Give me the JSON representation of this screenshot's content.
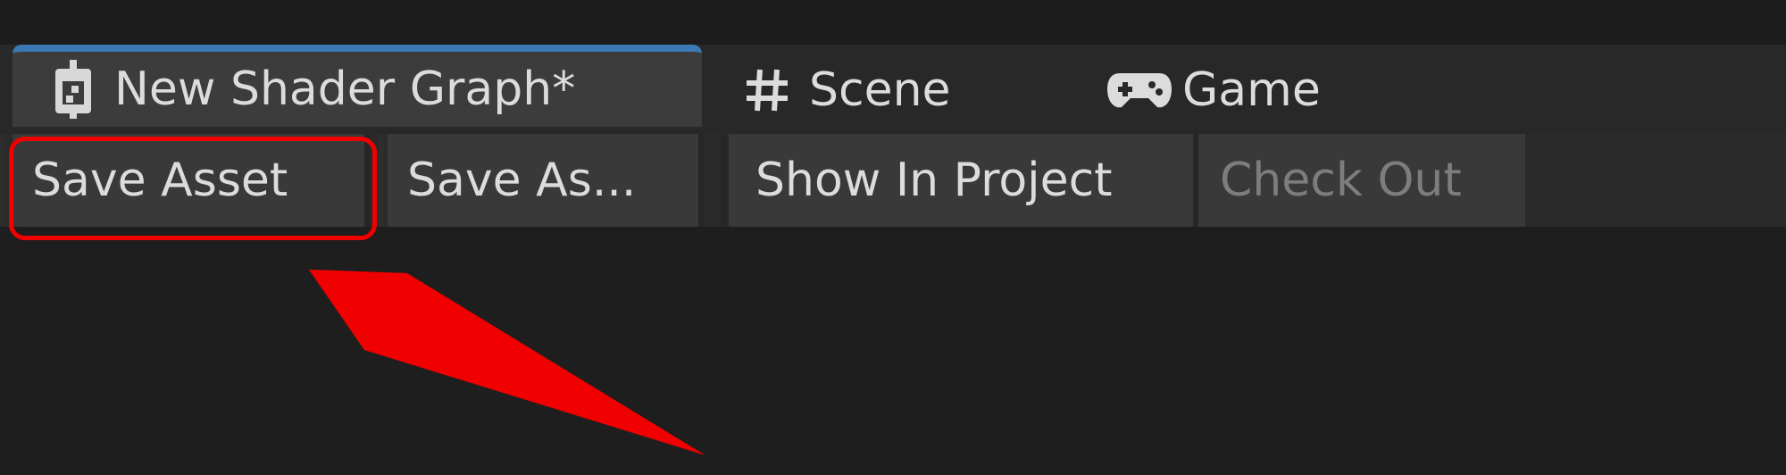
{
  "window": {
    "tabs": [
      {
        "label": "New Shader Graph*",
        "icon": "shader-graph-icon",
        "active": true
      },
      {
        "label": "Scene",
        "icon": "hash-grid-icon",
        "active": false
      },
      {
        "label": "Game",
        "icon": "gamepad-icon",
        "active": false
      }
    ]
  },
  "toolbar": {
    "save_asset_label": "Save Asset",
    "save_as_label": "Save As...",
    "show_in_project_label": "Show In Project",
    "check_out_label": "Check Out"
  },
  "colors": {
    "active_tab_accent": "#3a79b4",
    "annotation": "#f10000",
    "disabled_text": "#7d7d7d"
  },
  "annotation": {
    "type": "callout-arrow",
    "target": "save-asset-button"
  }
}
